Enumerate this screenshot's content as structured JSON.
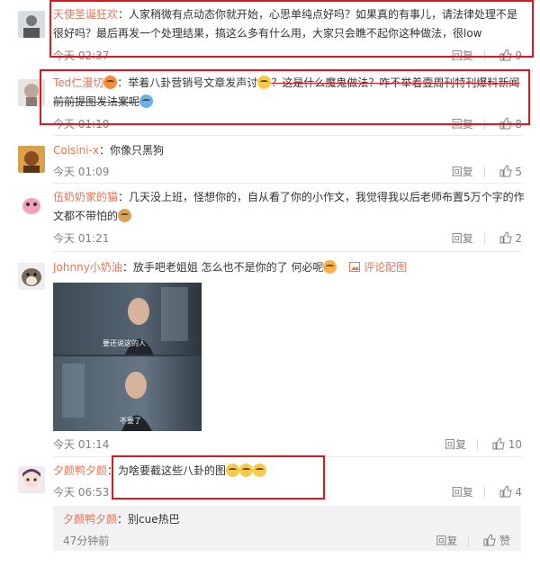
{
  "comments": [
    {
      "user": "天使圣诞狂欢",
      "text": "：人家稍微有点动态你就开始，心思单纯点好吗？如果真的有事儿，请法律处理不是很好吗？最后再发一个处理结果，搞这么多有什么用，大家只会瞧不起你这种做法，很low",
      "time": "今天 02:37",
      "reply": "回复",
      "likes": "9"
    },
    {
      "user": "Ted仁漫切",
      "text_a": "：举着八卦营销号文章发声讨",
      "text_b": "？这是什么魔鬼做法？咋不举着壹周刊特刊爆料新闻前前提图发法案呢",
      "time": "今天 01:10",
      "reply": "回复",
      "likes": "8"
    },
    {
      "user": "Coisini-x",
      "text": "：你像只黑狗",
      "time": "今天 01:09",
      "reply": "回复",
      "likes": "5"
    },
    {
      "user": "伍奶奶家的猫",
      "text": "：几天没上班，怪想你的，自从看了你的小作文，我觉得我以后老师布置5万个字的作文都不带怕的",
      "time": "今天 01:21",
      "reply": "回复",
      "likes": "2"
    },
    {
      "user": "Johnny小奶油",
      "text": "：放手吧老姐姐 怎么也不是你的了 何必呢",
      "pic_link": "评论配图",
      "subtitle_top": "要还说这的人",
      "subtitle_bottom": "不要了",
      "time": "今天 01:14",
      "reply": "回复",
      "likes": "10"
    },
    {
      "user": "夕颜鸭夕颜",
      "text": "：为啥要截这些八卦的图",
      "time": "今天 06:53",
      "reply": "回复",
      "likes": "4"
    }
  ],
  "nested_reply": {
    "user": "夕颜鸭夕颜",
    "text": "：别cue热巴",
    "time": "47分钟前",
    "reply": "回复",
    "like": "赞"
  },
  "colors": {
    "username": "#eb7350",
    "highlight_box": "#e0161e"
  }
}
